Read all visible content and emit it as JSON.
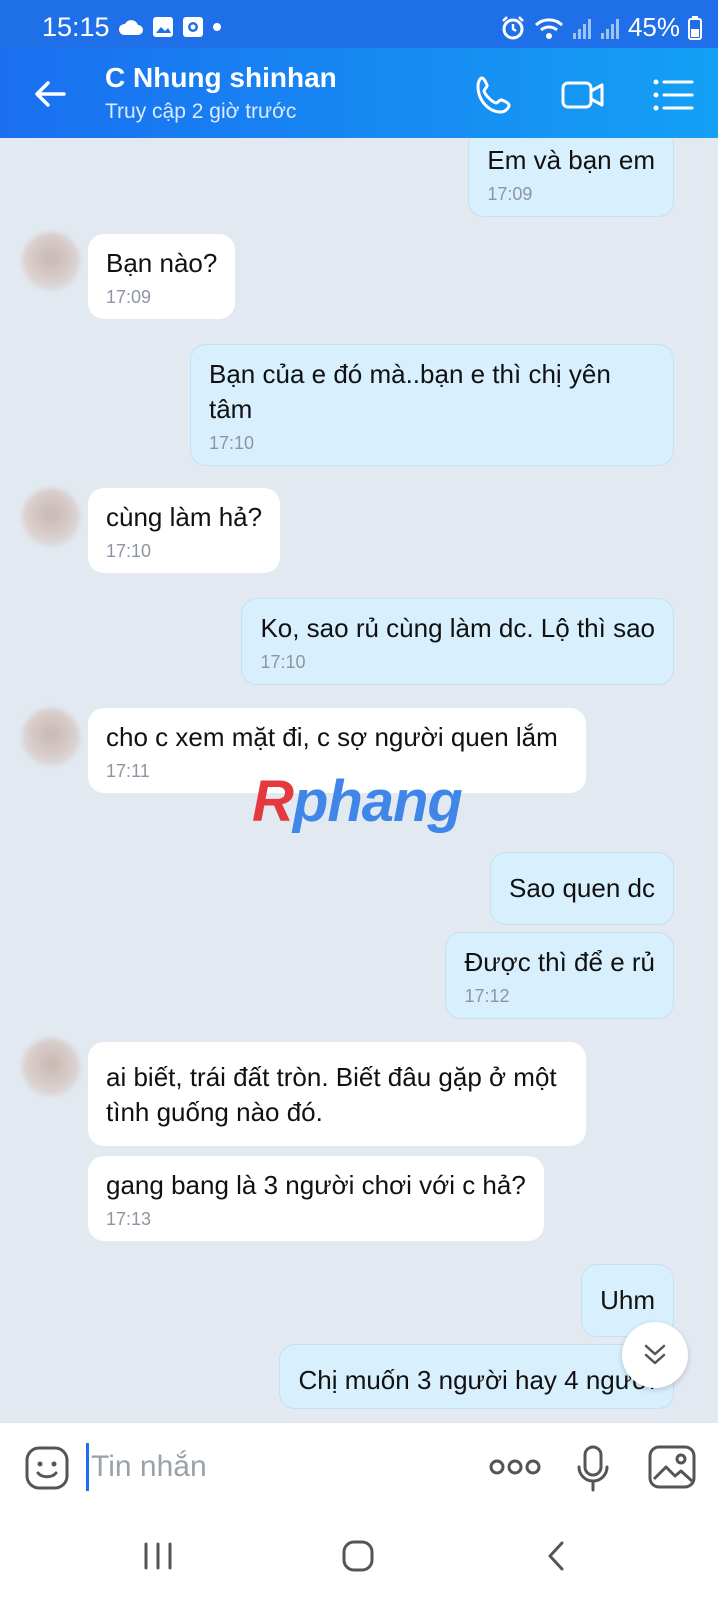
{
  "status_bar": {
    "time": "15:15",
    "battery": "45%",
    "icons": [
      "cloud-icon",
      "gallery-icon",
      "screen-record-icon",
      "dot-icon",
      "alarm-icon",
      "wifi-icon",
      "signal-icon",
      "signal-icon",
      "battery-icon"
    ]
  },
  "header": {
    "title": "C Nhung shinhan",
    "subtitle": "Truy cập 2 giờ trước",
    "accent_color": "#1a6ff0"
  },
  "messages": [
    {
      "side": "out",
      "text": "Em và bạn em",
      "time": "17:09"
    },
    {
      "side": "in",
      "text": "Bạn nào?",
      "time": "17:09"
    },
    {
      "side": "out",
      "text": "Bạn của e đó mà..bạn e thì chị yên tâm",
      "time": "17:10"
    },
    {
      "side": "in",
      "text": "cùng làm hả?",
      "time": "17:10"
    },
    {
      "side": "out",
      "text": "Ko, sao rủ cùng làm dc. Lộ thì sao",
      "time": "17:10"
    },
    {
      "side": "in",
      "text": "cho c xem mặt đi, c sợ người quen lắm",
      "time": "17:11"
    },
    {
      "side": "out",
      "text": "Sao quen dc",
      "time": ""
    },
    {
      "side": "out",
      "text": "Được thì để e rủ",
      "time": "17:12"
    },
    {
      "side": "in",
      "text": "ai biết, trái đất tròn. Biết đâu gặp ở một tình guống nào đó.",
      "time": ""
    },
    {
      "side": "in",
      "text": "gang bang là 3 người chơi với c hả?",
      "time": "17:13"
    },
    {
      "side": "out",
      "text": "Uhm",
      "time": ""
    },
    {
      "side": "out",
      "text": "Chị muốn 3 người hay 4 người",
      "time": ""
    }
  ],
  "watermark": {
    "first": "R",
    "rest": "phang"
  },
  "input": {
    "placeholder": "Tin nhắn"
  }
}
